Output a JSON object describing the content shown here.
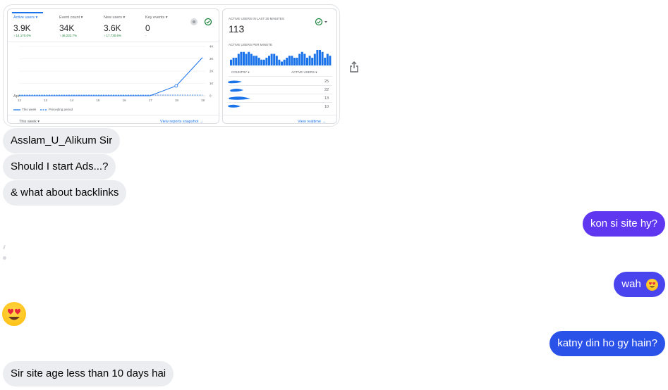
{
  "attachment": {
    "left_card": {
      "metrics": [
        {
          "label": "Active users ▾",
          "value": "3.9K",
          "change": "↑ 14,170.0%"
        },
        {
          "label": "Event count ▾",
          "value": "34K",
          "change": "↑ 46,232.7%"
        },
        {
          "label": "New users ▾",
          "value": "3.6K",
          "change": "↑ 17,730.6%"
        },
        {
          "label": "Key events ▾",
          "value": "0",
          "change": "-"
        }
      ],
      "y_ticks": [
        "4K",
        "3K",
        "2K",
        "1K",
        "0"
      ],
      "x_ticks": [
        "12",
        "13",
        "14",
        "15",
        "16",
        "17",
        "18",
        "19"
      ],
      "x_sub": "Apr",
      "legend_this": "This week",
      "legend_prev": "Preceding period",
      "period_select": "This week ▾",
      "link": "View reports snapshot →"
    },
    "right_card": {
      "title": "ACTIVE USERS IN LAST 30 MINUTES",
      "value": "113",
      "per_minute_label": "ACTIVE USERS PER MINUTE",
      "col_country": "COUNTRY ▾",
      "col_users": "ACTIVE USERS ▾",
      "rows": [
        "25",
        "22",
        "13",
        "10"
      ],
      "link": "View realtime →"
    },
    "chart_data": {
      "type": "line",
      "x": [
        "12",
        "13",
        "14",
        "15",
        "16",
        "17",
        "18",
        "19"
      ],
      "series": [
        {
          "name": "This week",
          "values": [
            0,
            0,
            0,
            0,
            0,
            0,
            800,
            3100
          ]
        }
      ],
      "ylim": [
        0,
        4000
      ]
    },
    "realtime_bars": [
      3,
      4,
      4,
      6,
      7,
      7,
      6,
      7,
      6,
      5,
      5,
      4,
      3,
      3,
      4,
      5,
      6,
      6,
      5,
      3,
      2,
      3,
      4,
      5,
      5,
      4,
      4,
      6,
      7,
      6,
      4,
      5,
      4,
      6,
      8,
      8,
      7,
      4,
      6,
      5
    ]
  },
  "messages": [
    {
      "text": "Asslam_U_Alikum Sir"
    },
    {
      "text": "Should I start Ads...?"
    },
    {
      "text": "& what about backlinks"
    },
    {
      "text": "kon si site hy?"
    },
    {
      "text": "wah"
    },
    {
      "text": "katny din ho gy hain?"
    },
    {
      "text": "Sir site age less than 10 days hai"
    }
  ],
  "colors": {
    "incoming_bubble": "#ebedf0",
    "outgoing_purple": "#5f37f0",
    "outgoing_blue": "#2b52e8",
    "analytics_blue": "#1a73e8"
  }
}
